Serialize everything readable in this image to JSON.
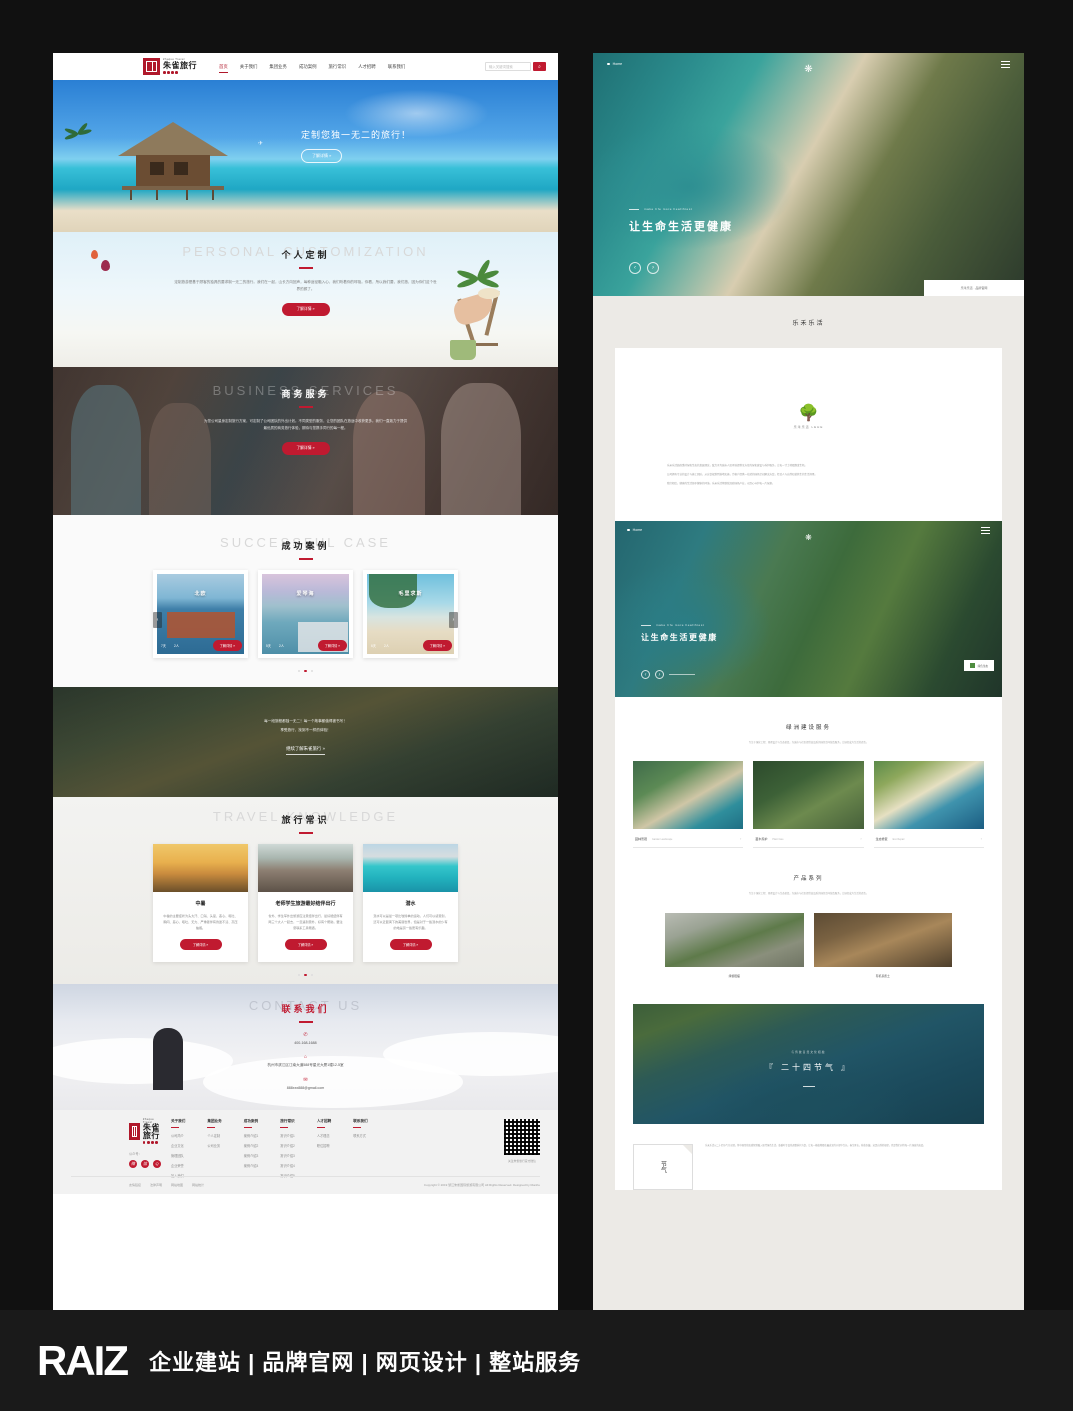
{
  "left_site": {
    "logo": {
      "en": "Zhuque Travel",
      "cn": "朱雀旅行"
    },
    "nav": [
      {
        "label": "首页",
        "active": true
      },
      {
        "label": "关于我们",
        "active": false
      },
      {
        "label": "集团业务",
        "active": false
      },
      {
        "label": "成功案例",
        "active": false
      },
      {
        "label": "旅行常识",
        "active": false
      },
      {
        "label": "人才招聘",
        "active": false
      },
      {
        "label": "联系我们",
        "active": false
      }
    ],
    "search": {
      "placeholder": "输入关键词搜索",
      "icon": "search-icon"
    },
    "hero": {
      "headline": "定制您独一无二的旅行！",
      "button": "了解详情 »"
    },
    "personal": {
      "en": "PERSONAL CUSTOMIZATION",
      "cn": "个人定制",
      "body": "定制旅游是基于顾客的独具的要求制一无二的旅行。我们在一起，山长方向回声，每种途径融入心，我们听着你的呼吸。你看，所以我们要，我们旅，因为你们这个世界的颜了。",
      "button": "了解详情 »"
    },
    "business": {
      "en": "BUSINESS SERVICES",
      "cn": "商务服务",
      "body": "为您公司量身定制旅行方案，可定制了公司团队的外出计划。不同类型的服务，让您的团队在旅途中收获更多。我们一直致力于提供最优质的商务旅行体验，期待与您携手同行的每一程。",
      "button": "了解详情 »"
    },
    "success": {
      "en": "SUCCESSFUL CASE",
      "cn": "成功案例",
      "cards": [
        {
          "title": "北欧",
          "days": "7天",
          "people": "2人",
          "button": "了解详情 »"
        },
        {
          "title": "爱琴海",
          "days": "5天",
          "people": "2人",
          "button": "了解详情 »"
        },
        {
          "title": "毛里求斯",
          "days": "6天",
          "people": "2人",
          "button": "了解详情 »"
        }
      ],
      "prev_icon": "chevron-left-icon",
      "next_icon": "chevron-right-icon"
    },
    "mountain": {
      "line1": "每一段旅程都独一无二！每一个故事都值得被书写！",
      "line2": "享受旅行，找到不一样的体验！",
      "link": "继续了解朱雀旅行 »"
    },
    "knowledge": {
      "en": "TRAVEL KNOWLEDGE",
      "cn": "旅行常识",
      "cards": [
        {
          "title": "中暑",
          "body": "中暑的主要症状为头大汗、口渴、头晕、恶心、呕吐、胸闷、恶心、呕吐、无力、严重者伴有昏迷不清、高压抽搐。",
          "button": "了解详情 »"
        },
        {
          "title": "老师学生旅游最好结伴出行",
          "body": "省外、学生军外出旅游应注意结伴出行，最好能结伴有两三个大人一起去，一旦遇到意外，好有个帮助。要注意联系工具畅通。",
          "button": "了解详情 »"
        },
        {
          "title": "潜水",
          "body": "潜水可以是最一项比较简单的运动，人们可以感受到，还可以近距离下的美丽世界，但是对于一些潜水的少有的地是另一些更有乐趣。",
          "button": "了解详情 »"
        }
      ]
    },
    "contact": {
      "en": "CONTACT US",
      "cn": "联系我们",
      "phone_icon": "phone-icon",
      "phone": "400-168-1688",
      "address_icon": "location-icon",
      "address": "杭州市滨江区江南大道588号星光大厦1幢12-5室",
      "email_icon": "mail-icon",
      "email": "888xxx888@gmail.com"
    },
    "footer": {
      "social_label": "公众号：",
      "social": [
        "weibo-icon",
        "wechat-icon",
        "qq-icon"
      ],
      "columns": [
        {
          "head": "关于我们",
          "links": [
            "公司简介",
            "企业文化",
            "管理团队",
            "企业荣誉",
            "加入我们"
          ]
        },
        {
          "head": "集团业务",
          "links": [
            "个人定制",
            "公司业务"
          ]
        },
        {
          "head": "成功案例",
          "links": [
            "案例介绍1",
            "案例介绍2",
            "案例介绍3",
            "案例介绍4"
          ]
        },
        {
          "head": "旅行常识",
          "links": [
            "常识介绍1",
            "常识介绍2",
            "常识介绍3",
            "常识介绍4",
            "常识介绍5"
          ]
        },
        {
          "head": "人才招聘",
          "links": [
            "人才理念",
            "职位招聘"
          ]
        },
        {
          "head": "联系我们",
          "links": [
            "联系方式"
          ]
        }
      ],
      "qr_caption": "关注朱雀旅行官方微信",
      "bottom_links": [
        "友情链接",
        "法律声明",
        "网站地图",
        "网站统计"
      ],
      "copyright": "Copyright © 2019 浙江朱雀国际旅游有限公司  All Rights Reserved.  Designed by Rianhu"
    }
  },
  "right_site": {
    "header": {
      "home": "Home",
      "brand_icon": "snowflake-logo",
      "menu_icon": "hamburger-icon"
    },
    "hero": {
      "kicker": "make life more healthiest",
      "headline": "让生命生活更健康",
      "prev_icon": "circle-prev-icon",
      "next_icon": "circle-next-icon",
      "tag": "乐禾乐活 · 品牌官网"
    },
    "band_title": "乐禾乐活",
    "logo_block": {
      "icon": "green-tree-icon",
      "caption": "乐禾乐活 LEHE"
    },
    "intro": [
      "乐禾乐活始终秉持绿色生态的发展理念，致力于为城市人居环境提供全方位的绿化建设与养护服务，让每一寸土地都焕发生机。",
      "公司拥有专业的设计与施工团队，从方案规划到落地实施，为客户提供一站式的绿色空间解决方案，打造人与自然和谐共生的生活场景。",
      "我们相信，健康的生活源于健康的环境。乐禾乐活将继续深耕绿色产业，以匠心守护每一片绿意。"
    ],
    "inner_hero": {
      "kicker": "make life more healthiest",
      "headline": "让生命生活更健康",
      "tag": "绿色生态"
    },
    "services": {
      "title": "绿洲建设服务",
      "desc": "专注于绿化工程、景观设计与生态修复，为城市与社区提供高品质的绿色空间营造服务，让绿色成为生活的底色。",
      "items": [
        {
          "cn": "园林景观",
          "en": "Garden Landscape",
          "more": "›"
        },
        {
          "cn": "苗木养护",
          "en": "Plant Care",
          "more": "›"
        },
        {
          "cn": "生态修复",
          "en": "Eco Repair",
          "more": "›"
        }
      ]
    },
    "products": {
      "title": "产品系列",
      "desc": "专注于绿化工程、景观设计与生态修复，为城市与社区提供高品质的绿色空间营造服务，让绿色成为生活的底色。",
      "items": [
        {
          "cap": "绿植租摆"
        },
        {
          "cap": "有机基质土"
        }
      ]
    },
    "cta": {
      "kicker": "与传统自然文化相融",
      "headline": "『 二十四节气 』",
      "rule": true
    },
    "last": {
      "card_text": "节气",
      "body": "乐禾乐活以二十四节气为灵感，将中国传统农耕智慧融入现代绿色生活。依循时令变化调整养护方案，让每一株植物都在最适宜的节律中生长。春生夏长，秋收冬藏，这是自然的规律，也是我们对待每一片绿意的态度。"
    }
  },
  "brandbar": {
    "logo": "RAIZ",
    "tagline": "企业建站 | 品牌官网 | 网页设计 | 整站服务"
  }
}
